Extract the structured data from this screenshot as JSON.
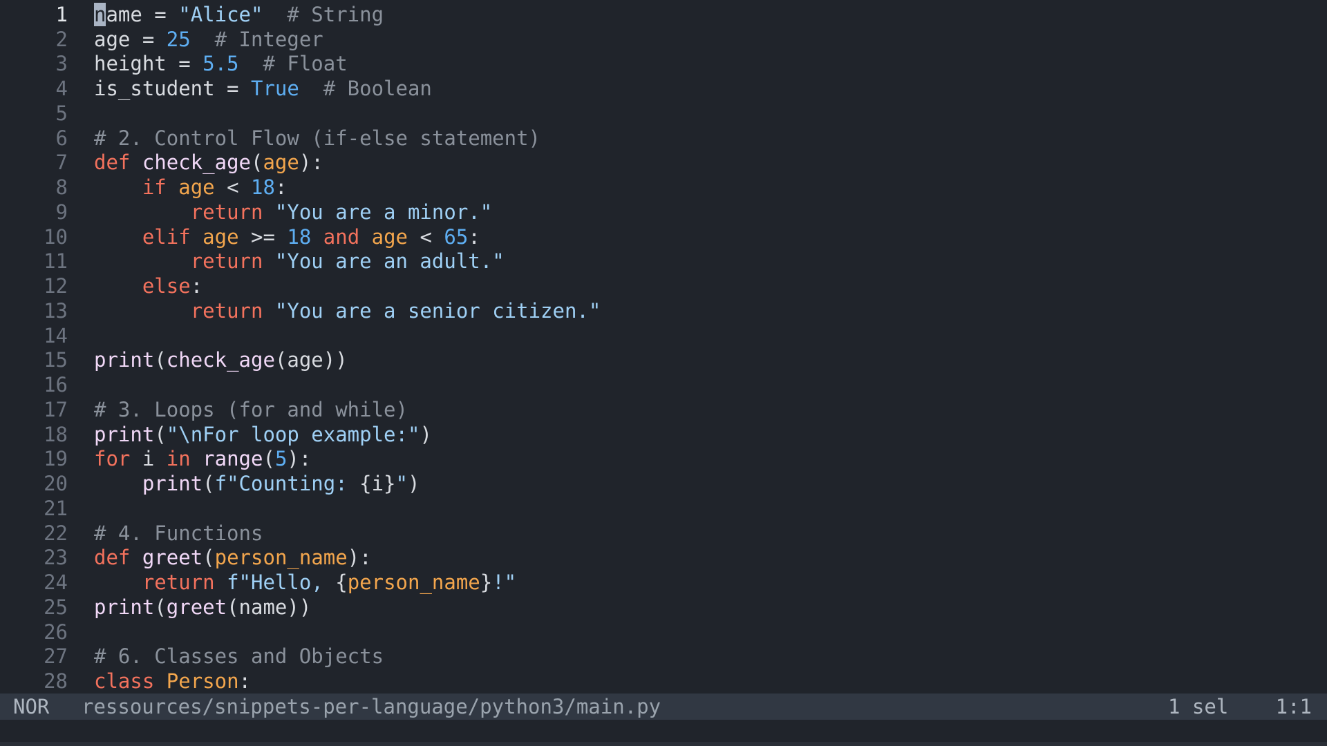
{
  "editor": {
    "lines": [
      {
        "num": "1",
        "tokens": [
          [
            "cursor",
            "n"
          ],
          [
            "txt",
            "ame = "
          ],
          [
            "str",
            "\"Alice\""
          ],
          [
            "txt",
            "  "
          ],
          [
            "cmt",
            "# String"
          ]
        ]
      },
      {
        "num": "2",
        "tokens": [
          [
            "txt",
            "age = "
          ],
          [
            "num",
            "25"
          ],
          [
            "txt",
            "  "
          ],
          [
            "cmt",
            "# Integer"
          ]
        ]
      },
      {
        "num": "3",
        "tokens": [
          [
            "txt",
            "height = "
          ],
          [
            "num",
            "5.5"
          ],
          [
            "txt",
            "  "
          ],
          [
            "cmt",
            "# Float"
          ]
        ]
      },
      {
        "num": "4",
        "tokens": [
          [
            "txt",
            "is_student = "
          ],
          [
            "num",
            "True"
          ],
          [
            "txt",
            "  "
          ],
          [
            "cmt",
            "# Boolean"
          ]
        ]
      },
      {
        "num": "5",
        "tokens": []
      },
      {
        "num": "6",
        "tokens": [
          [
            "cmt",
            "# 2. Control Flow (if-else statement)"
          ]
        ]
      },
      {
        "num": "7",
        "tokens": [
          [
            "kw",
            "def"
          ],
          [
            "txt",
            " "
          ],
          [
            "fn",
            "check_age"
          ],
          [
            "txt",
            "("
          ],
          [
            "par",
            "age"
          ],
          [
            "txt",
            "):"
          ]
        ]
      },
      {
        "num": "8",
        "tokens": [
          [
            "txt",
            "    "
          ],
          [
            "kw",
            "if"
          ],
          [
            "txt",
            " "
          ],
          [
            "par",
            "age"
          ],
          [
            "txt",
            " < "
          ],
          [
            "num",
            "18"
          ],
          [
            "txt",
            ":"
          ]
        ]
      },
      {
        "num": "9",
        "tokens": [
          [
            "txt",
            "        "
          ],
          [
            "kw",
            "return"
          ],
          [
            "txt",
            " "
          ],
          [
            "str",
            "\"You are a minor.\""
          ]
        ]
      },
      {
        "num": "10",
        "tokens": [
          [
            "txt",
            "    "
          ],
          [
            "kw",
            "elif"
          ],
          [
            "txt",
            " "
          ],
          [
            "par",
            "age"
          ],
          [
            "txt",
            " >= "
          ],
          [
            "num",
            "18"
          ],
          [
            "txt",
            " "
          ],
          [
            "kw",
            "and"
          ],
          [
            "txt",
            " "
          ],
          [
            "par",
            "age"
          ],
          [
            "txt",
            " < "
          ],
          [
            "num",
            "65"
          ],
          [
            "txt",
            ":"
          ]
        ]
      },
      {
        "num": "11",
        "tokens": [
          [
            "txt",
            "        "
          ],
          [
            "kw",
            "return"
          ],
          [
            "txt",
            " "
          ],
          [
            "str",
            "\"You are an adult.\""
          ]
        ]
      },
      {
        "num": "12",
        "tokens": [
          [
            "txt",
            "    "
          ],
          [
            "kw",
            "else"
          ],
          [
            "txt",
            ":"
          ]
        ]
      },
      {
        "num": "13",
        "tokens": [
          [
            "txt",
            "        "
          ],
          [
            "kw",
            "return"
          ],
          [
            "txt",
            " "
          ],
          [
            "str",
            "\"You are a senior citizen.\""
          ]
        ]
      },
      {
        "num": "14",
        "tokens": []
      },
      {
        "num": "15",
        "tokens": [
          [
            "fn",
            "print"
          ],
          [
            "txt",
            "("
          ],
          [
            "fn",
            "check_age"
          ],
          [
            "txt",
            "(age))"
          ]
        ]
      },
      {
        "num": "16",
        "tokens": []
      },
      {
        "num": "17",
        "tokens": [
          [
            "cmt",
            "# 3. Loops (for and while)"
          ]
        ]
      },
      {
        "num": "18",
        "tokens": [
          [
            "fn",
            "print"
          ],
          [
            "txt",
            "("
          ],
          [
            "str",
            "\"\\nFor loop example:\""
          ],
          [
            "txt",
            ")"
          ]
        ]
      },
      {
        "num": "19",
        "tokens": [
          [
            "kw",
            "for"
          ],
          [
            "txt",
            " i "
          ],
          [
            "kw",
            "in"
          ],
          [
            "txt",
            " "
          ],
          [
            "fn",
            "range"
          ],
          [
            "txt",
            "("
          ],
          [
            "num",
            "5"
          ],
          [
            "txt",
            "):"
          ]
        ]
      },
      {
        "num": "20",
        "tokens": [
          [
            "txt",
            "    "
          ],
          [
            "fn",
            "print"
          ],
          [
            "txt",
            "("
          ],
          [
            "str",
            "f\"Counting: "
          ],
          [
            "txt",
            "{i}"
          ],
          [
            "str",
            "\""
          ],
          [
            "txt",
            ")"
          ]
        ]
      },
      {
        "num": "21",
        "tokens": []
      },
      {
        "num": "22",
        "tokens": [
          [
            "cmt",
            "# 4. Functions"
          ]
        ]
      },
      {
        "num": "23",
        "tokens": [
          [
            "kw",
            "def"
          ],
          [
            "txt",
            " "
          ],
          [
            "fn",
            "greet"
          ],
          [
            "txt",
            "("
          ],
          [
            "par",
            "person_name"
          ],
          [
            "txt",
            "):"
          ]
        ]
      },
      {
        "num": "24",
        "tokens": [
          [
            "txt",
            "    "
          ],
          [
            "kw",
            "return"
          ],
          [
            "txt",
            " "
          ],
          [
            "str",
            "f\"Hello, "
          ],
          [
            "txt",
            "{"
          ],
          [
            "par",
            "person_name"
          ],
          [
            "txt",
            "}"
          ],
          [
            "str",
            "!\""
          ]
        ]
      },
      {
        "num": "25",
        "tokens": [
          [
            "fn",
            "print"
          ],
          [
            "txt",
            "("
          ],
          [
            "fn",
            "greet"
          ],
          [
            "txt",
            "(name))"
          ]
        ]
      },
      {
        "num": "26",
        "tokens": []
      },
      {
        "num": "27",
        "tokens": [
          [
            "cmt",
            "# 6. Classes and Objects"
          ]
        ]
      },
      {
        "num": "28",
        "tokens": [
          [
            "kw",
            "class"
          ],
          [
            "txt",
            " "
          ],
          [
            "par",
            "Person"
          ],
          [
            "txt",
            ":"
          ]
        ]
      }
    ],
    "current_line": "1"
  },
  "statusbar": {
    "mode": "NOR",
    "filepath": "ressources/snippets-per-language/python3/main.py",
    "selection": "1 sel",
    "position": "1:1"
  },
  "colors": {
    "background": "#20242b",
    "statusbar": "#313843",
    "keyword": "#f3725d",
    "string": "#9fd0f5",
    "number": "#5eaef2",
    "comment": "#8a919b",
    "function": "#f1d8f7",
    "parameter": "#f3a64d"
  }
}
